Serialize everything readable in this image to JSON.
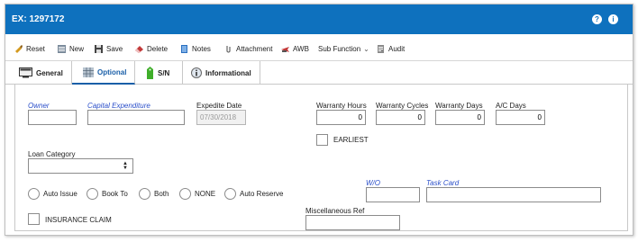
{
  "window": {
    "title": "EX: 1297172",
    "help_icon": "question-circle-icon",
    "info_icon": "info-circle-icon",
    "help_glyph": "?",
    "info_glyph": "i"
  },
  "toolbar": {
    "reset": "Reset",
    "new": "New",
    "save": "Save",
    "delete": "Delete",
    "notes": "Notes",
    "attachment": "Attachment",
    "awb": "AWB",
    "sub_function": "Sub Function",
    "sub_function_caret": "⌄",
    "audit": "Audit"
  },
  "tabs": [
    {
      "label": "General",
      "icon": "monitor-icon"
    },
    {
      "label": "Optional",
      "icon": "grid-icon",
      "active": true
    },
    {
      "label": "S/N",
      "icon": "tag-icon"
    },
    {
      "label": "Informational",
      "icon": "info-icon"
    }
  ],
  "form": {
    "owner": {
      "label": "Owner",
      "value": ""
    },
    "capital_expenditure": {
      "label": "Capital Expenditure",
      "value": ""
    },
    "expedite_date": {
      "label": "Expedite Date",
      "value": "07/30/2018"
    },
    "warranty_hours": {
      "label": "Warranty Hours",
      "value": "0"
    },
    "warranty_cycles": {
      "label": "Warranty Cycles",
      "value": "0"
    },
    "warranty_days": {
      "label": "Warranty Days",
      "value": "0"
    },
    "ac_days": {
      "label": "A/C Days",
      "value": "0"
    },
    "earliest": {
      "label": "EARLIEST",
      "checked": false
    },
    "loan_category": {
      "label": "Loan Category",
      "value": "",
      "arrows": "▲\n▼"
    },
    "radios": [
      {
        "label": "Auto Issue",
        "checked": false
      },
      {
        "label": "Book To",
        "checked": false
      },
      {
        "label": "Both",
        "checked": false
      },
      {
        "label": "NONE",
        "checked": false
      },
      {
        "label": "Auto Reserve",
        "checked": false
      }
    ],
    "wo": {
      "label": "W/O",
      "value": ""
    },
    "task_card": {
      "label": "Task Card",
      "value": ""
    },
    "insurance_claim": {
      "label": "INSURANCE CLAIM",
      "checked": false
    },
    "miscellaneous_ref": {
      "label": "Miscellaneous Ref",
      "value": ""
    }
  }
}
